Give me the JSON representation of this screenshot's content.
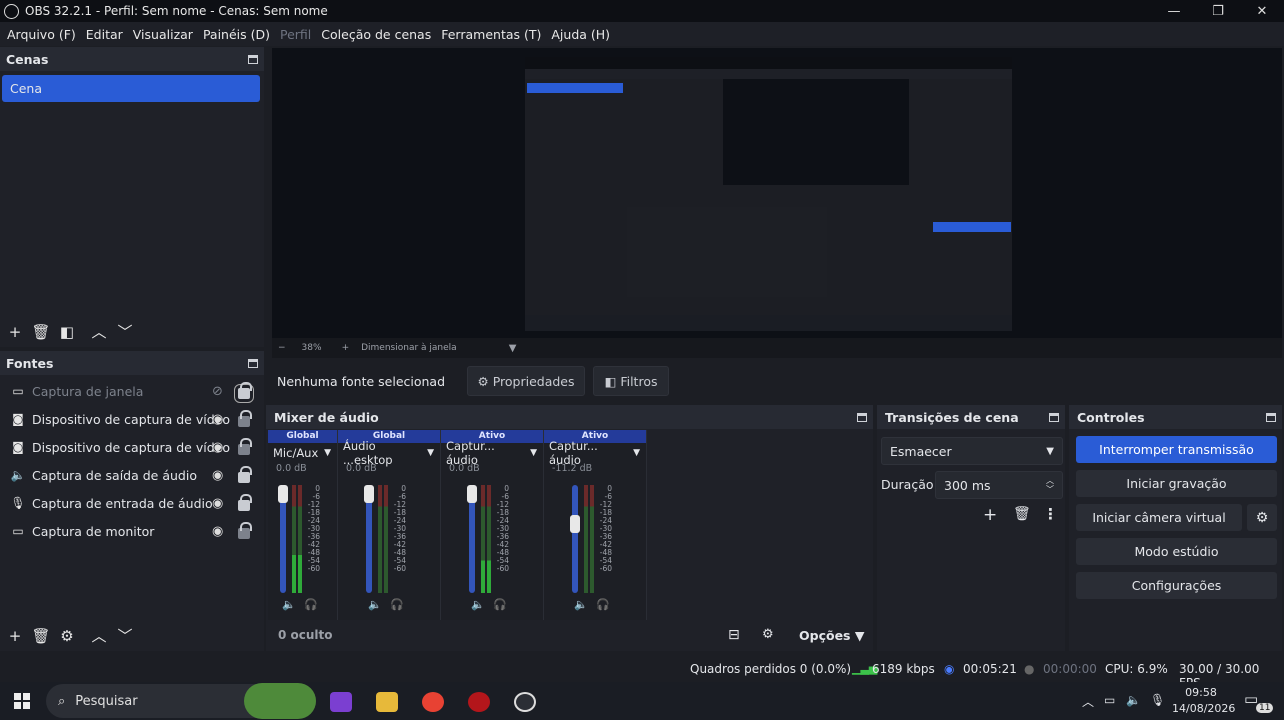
{
  "window": {
    "title": "OBS 32.2.1 - Perfil: Sem nome - Cenas: Sem nome",
    "minimize": "—",
    "maximize": "❐",
    "close": "✕"
  },
  "menu": [
    "Arquivo (F)",
    "Editar",
    "Visualizar",
    "Painéis (D)",
    "Perfil",
    "Coleção de cenas",
    "Ferramentas (T)",
    "Ajuda (H)"
  ],
  "scenes": {
    "title": "Cenas",
    "items": [
      "Cena"
    ]
  },
  "sources": {
    "title": "Fontes",
    "items": [
      {
        "name": "Captura de janela",
        "icon": "window-icon",
        "hidden": true
      },
      {
        "name": "Dispositivo de captura de vídeo",
        "icon": "camera-icon"
      },
      {
        "name": "Dispositivo de captura de vídeo",
        "icon": "camera-icon"
      },
      {
        "name": "Captura de saída de áudio",
        "icon": "speaker-icon"
      },
      {
        "name": "Captura de entrada de áudio",
        "icon": "microphone-icon"
      },
      {
        "name": "Captura de monitor",
        "icon": "monitor-icon"
      }
    ]
  },
  "preview": {
    "zoom": "38%",
    "scale_mode": "Dimensionar à janela"
  },
  "source_props": {
    "none_selected": "Nenhuma fonte selecionad",
    "properties": "Propriedades",
    "filters": "Filtros"
  },
  "mixer": {
    "title": "Mixer de áudio",
    "hidden_count": "0 oculto",
    "options": "Opções",
    "ticks": [
      "0",
      "-6",
      "-12",
      "-18",
      "-24",
      "-30",
      "-36",
      "-42",
      "-48",
      "-54",
      "-60"
    ],
    "channels": [
      {
        "tag": "Global",
        "name": "Mic/Aux",
        "db": "0.0 dB",
        "level": 0.35
      },
      {
        "tag": "Global",
        "name": "Áudio ...esktop",
        "db": "0.0 dB",
        "level": 0.0
      },
      {
        "tag": "Ativo",
        "name": "Captur... áudio",
        "db": "0.0 dB",
        "level": 0.3
      },
      {
        "tag": "Ativo",
        "name": "Captur... áudio",
        "db": "-11.2 dB",
        "level": 0.0
      }
    ]
  },
  "transitions": {
    "title": "Transições de cena",
    "selected": "Esmaecer",
    "duration_label": "Duração",
    "duration": "300 ms"
  },
  "controls": {
    "title": "Controles",
    "stop_stream": "Interromper transmissão",
    "start_recording": "Iniciar gravação",
    "start_virtualcam": "Iniciar câmera virtual",
    "studio_mode": "Modo estúdio",
    "settings": "Configurações"
  },
  "status": {
    "dropped": "Quadros perdidos 0 (0.0%)",
    "bitrate": "6189 kbps",
    "stream_time": "00:05:21",
    "rec_time": "00:00:00",
    "cpu": "CPU: 6.9%",
    "fps": "30.00 / 30.00 FPS"
  },
  "taskbar": {
    "search": "Pesquisar",
    "time": "09:58",
    "date": "14/08/2026",
    "notif": "11"
  },
  "colors": {
    "accent": "#2a5cd6",
    "stream_active": "#2a5cd6"
  }
}
